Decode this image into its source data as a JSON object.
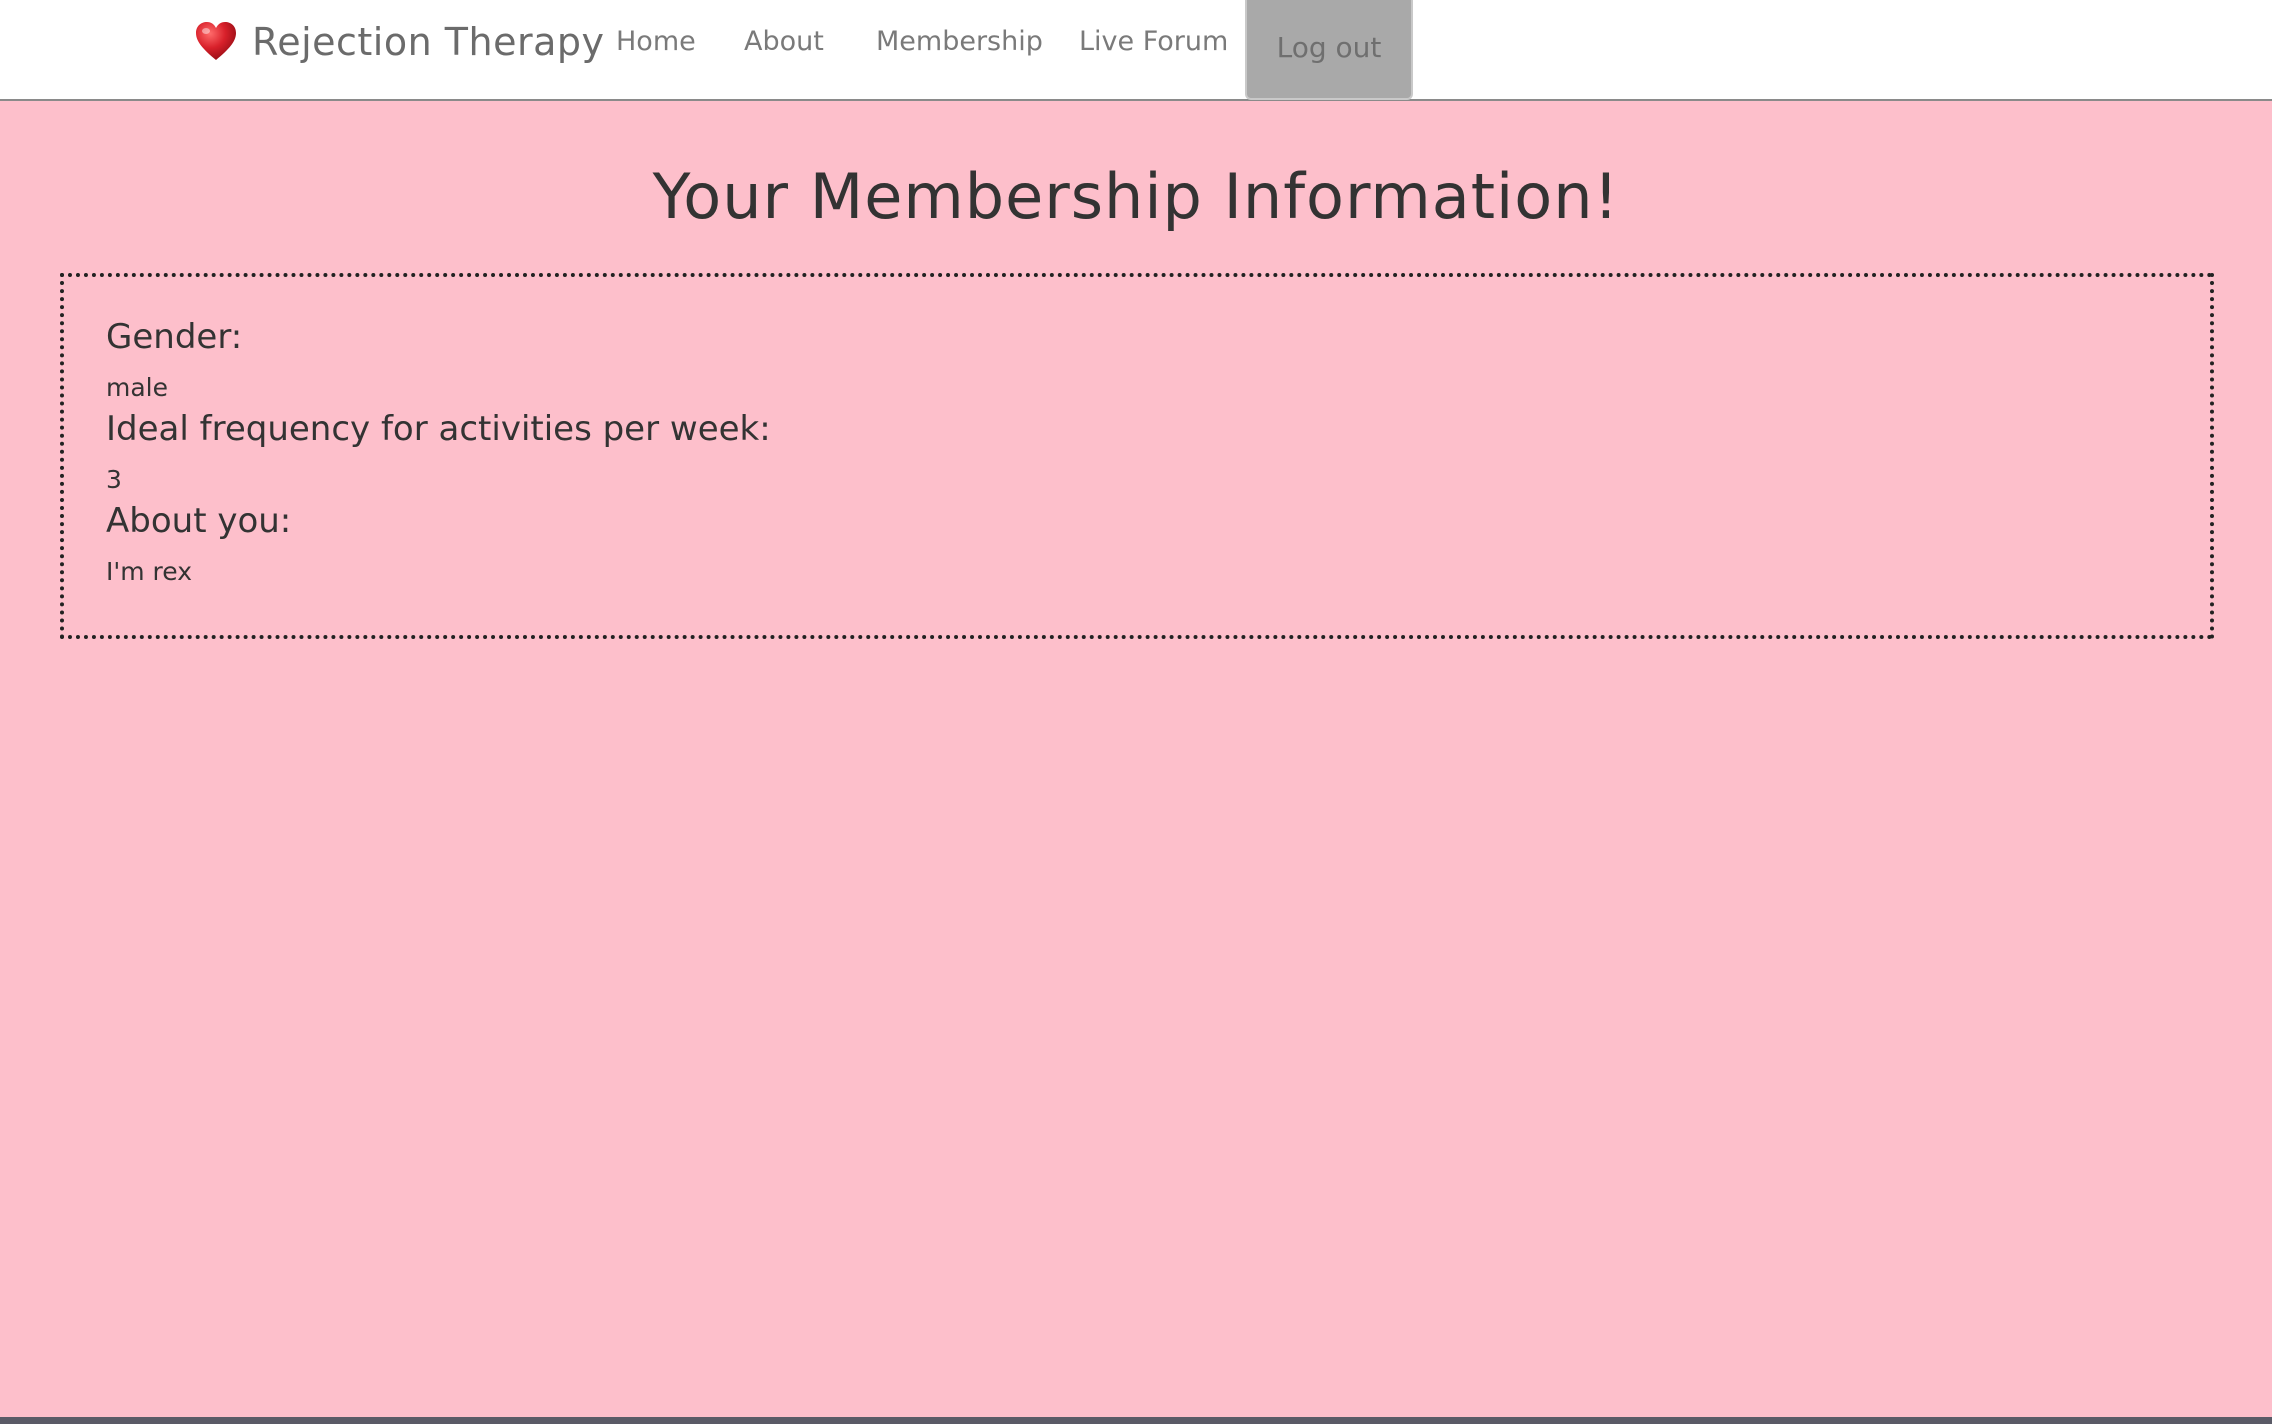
{
  "nav": {
    "brand": {
      "icon": "heart-icon",
      "name": "Rejection Therapy"
    },
    "links": [
      {
        "label": "Home"
      },
      {
        "label": "About"
      },
      {
        "label": "Membership"
      },
      {
        "label": "Live Forum"
      }
    ],
    "logout_label": "Log out"
  },
  "main": {
    "title": "Your Membership Information!",
    "fields": [
      {
        "label": "Gender:",
        "value": "male"
      },
      {
        "label": "Ideal frequency for activities per week:",
        "value": "3"
      },
      {
        "label": "About you:",
        "value": "I'm rex"
      }
    ]
  },
  "colors": {
    "background": "#fdbfcb",
    "navbar": "#ffffff",
    "logout_button": "#a9a9a9",
    "heart": "#d8202a",
    "text": "#333333"
  }
}
